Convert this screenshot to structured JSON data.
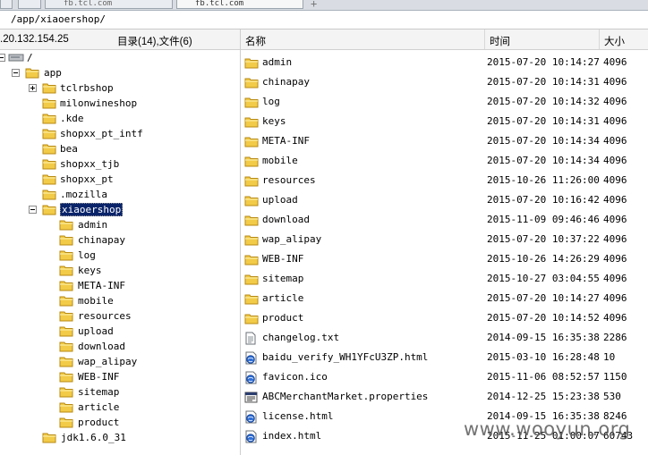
{
  "tabs": [
    {
      "label": "fb.tcl.com"
    },
    {
      "label": "fb.tcl.com"
    }
  ],
  "path": {
    "value": "/app/xiaoershop/"
  },
  "left_header": {
    "host": ".20.132.154.25",
    "summary": "目录(14),文件(6)"
  },
  "columns": {
    "name": "名称",
    "time": "时间",
    "size": "大小"
  },
  "tree": {
    "root": "/",
    "app": "app",
    "items": [
      {
        "label": "tclrbshop"
      },
      {
        "label": "milonwineshop"
      },
      {
        "label": ".kde"
      },
      {
        "label": "shopxx_pt_intf"
      },
      {
        "label": "bea"
      },
      {
        "label": "shopxx_tjb"
      },
      {
        "label": "shopxx_pt"
      },
      {
        "label": ".mozilla"
      },
      {
        "label": "xiaoershop"
      }
    ],
    "children": [
      {
        "label": "admin"
      },
      {
        "label": "chinapay"
      },
      {
        "label": "log"
      },
      {
        "label": "keys"
      },
      {
        "label": "META-INF"
      },
      {
        "label": "mobile"
      },
      {
        "label": "resources"
      },
      {
        "label": "upload"
      },
      {
        "label": "download"
      },
      {
        "label": "wap_alipay"
      },
      {
        "label": "WEB-INF"
      },
      {
        "label": "sitemap"
      },
      {
        "label": "article"
      },
      {
        "label": "product"
      }
    ],
    "last": "jdk1.6.0_31"
  },
  "files": [
    {
      "name": "admin",
      "time": "2015-07-20 10:14:27",
      "size": "4096",
      "icon": "folder-icon"
    },
    {
      "name": "chinapay",
      "time": "2015-07-20 10:14:31",
      "size": "4096",
      "icon": "folder-icon"
    },
    {
      "name": "log",
      "time": "2015-07-20 10:14:32",
      "size": "4096",
      "icon": "folder-icon"
    },
    {
      "name": "keys",
      "time": "2015-07-20 10:14:31",
      "size": "4096",
      "icon": "folder-icon"
    },
    {
      "name": "META-INF",
      "time": "2015-07-20 10:14:34",
      "size": "4096",
      "icon": "folder-icon"
    },
    {
      "name": "mobile",
      "time": "2015-07-20 10:14:34",
      "size": "4096",
      "icon": "folder-icon"
    },
    {
      "name": "resources",
      "time": "2015-10-26 11:26:00",
      "size": "4096",
      "icon": "folder-icon"
    },
    {
      "name": "upload",
      "time": "2015-07-20 10:16:42",
      "size": "4096",
      "icon": "folder-icon"
    },
    {
      "name": "download",
      "time": "2015-11-09 09:46:46",
      "size": "4096",
      "icon": "folder-icon"
    },
    {
      "name": "wap_alipay",
      "time": "2015-07-20 10:37:22",
      "size": "4096",
      "icon": "folder-icon"
    },
    {
      "name": "WEB-INF",
      "time": "2015-10-26 14:26:29",
      "size": "4096",
      "icon": "folder-icon"
    },
    {
      "name": "sitemap",
      "time": "2015-10-27 03:04:55",
      "size": "4096",
      "icon": "folder-icon"
    },
    {
      "name": "article",
      "time": "2015-07-20 10:14:27",
      "size": "4096",
      "icon": "folder-icon"
    },
    {
      "name": "product",
      "time": "2015-07-20 10:14:52",
      "size": "4096",
      "icon": "folder-icon"
    },
    {
      "name": "changelog.txt",
      "time": "2014-09-15 16:35:38",
      "size": "2286",
      "icon": "text-file-icon"
    },
    {
      "name": "baidu_verify_WH1YFcU3ZP.html",
      "time": "2015-03-10 16:28:48",
      "size": "10",
      "icon": "html-file-icon"
    },
    {
      "name": "favicon.ico",
      "time": "2015-11-06 08:52:57",
      "size": "1150",
      "icon": "html-file-icon"
    },
    {
      "name": "ABCMerchantMarket.properties",
      "time": "2014-12-25 15:23:38",
      "size": "530",
      "icon": "properties-file-icon"
    },
    {
      "name": "license.html",
      "time": "2014-09-15 16:35:38",
      "size": "8246",
      "icon": "html-file-icon"
    },
    {
      "name": "index.html",
      "time": "2015-11-25 01:00:07",
      "size": "60743",
      "icon": "html-file-icon"
    }
  ],
  "watermark": "www.wooyun.org"
}
